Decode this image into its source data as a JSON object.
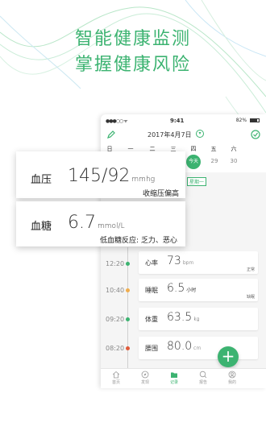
{
  "headline": {
    "line1": "智能健康监测",
    "line2": "掌握健康风险"
  },
  "status": {
    "time": "9:41",
    "battery": "82%"
  },
  "header": {
    "date": "2017年4月7日",
    "date_dropdown": "▾"
  },
  "week": {
    "days": [
      "日",
      "一",
      "二",
      "三",
      "四",
      "五",
      "六"
    ],
    "dates": [
      "今天",
      "29",
      "30"
    ],
    "weekday_tag": "星期一"
  },
  "blood_pressure": {
    "label": "血压",
    "value": "145/92",
    "unit": "mmhg",
    "note": "收缩压偏高"
  },
  "blood_sugar": {
    "label": "血糖",
    "value": "6.7",
    "unit": "mmol/L",
    "note": "低血糖反应: 乏力、恶心"
  },
  "timeline": [
    {
      "time": "12:20",
      "label": "心率",
      "value": "73",
      "unit": "bpm",
      "tag": "正常",
      "dot_color": "#3cb371"
    },
    {
      "time": "10:40",
      "label": "睡眠",
      "value": "6.5",
      "unit": "小时",
      "tag": "缺眠",
      "dot_color": "#f0ad4e"
    },
    {
      "time": "09:20",
      "label": "体重",
      "value": "63.5",
      "unit": "kg",
      "tag": "",
      "dot_color": "#3cb371"
    },
    {
      "time": "08:20",
      "label": "腰围",
      "value": "80.0",
      "unit": "cm",
      "tag": "",
      "dot_color": "#e05a3a"
    }
  ],
  "fab_label": "+",
  "tabs": [
    {
      "label": "首页",
      "icon": "home-icon"
    },
    {
      "label": "发现",
      "icon": "compass-icon"
    },
    {
      "label": "记录",
      "icon": "record-icon"
    },
    {
      "label": "报告",
      "icon": "report-icon"
    },
    {
      "label": "我的",
      "icon": "profile-icon"
    }
  ],
  "colors": {
    "accent": "#3cb371"
  }
}
